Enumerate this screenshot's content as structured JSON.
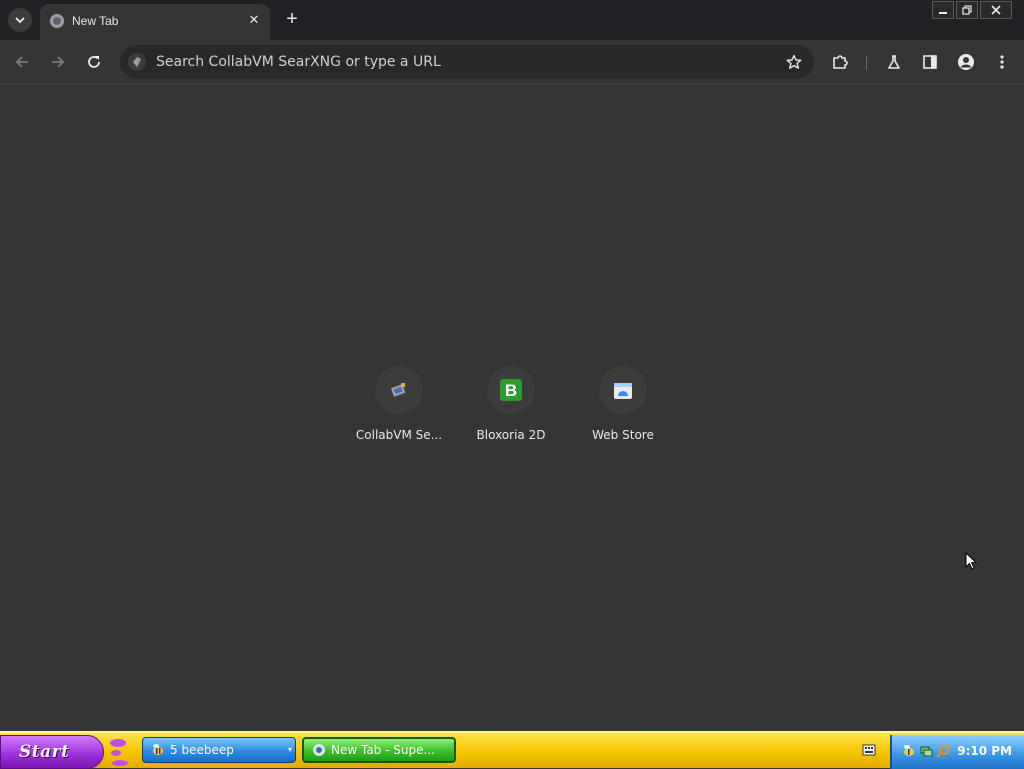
{
  "browser": {
    "tab": {
      "title": "New Tab"
    },
    "omnibox": {
      "placeholder": "Search CollabVM SearXNG or type a URL"
    }
  },
  "shortcuts": [
    {
      "label": "CollabVM Se...",
      "icon": "collabvm-icon"
    },
    {
      "label": "Bloxoria 2D",
      "icon": "bloxoria-icon"
    },
    {
      "label": "Web Store",
      "icon": "web-store-icon"
    }
  ],
  "taskbar": {
    "start_label": "Start",
    "tasks": [
      {
        "label": "5 beebeep",
        "icon": "bee-icon"
      },
      {
        "label": "New Tab - Supe...",
        "icon": "browser-icon"
      }
    ],
    "clock": "9:10 PM"
  },
  "colors": {
    "chrome_bg": "#202124",
    "content_bg": "#353535",
    "taskbar_yellow": "#f5c400",
    "start_purple": "#9b2fd6",
    "tray_blue": "#3a95e6",
    "active_task_green": "#3cc02a"
  }
}
